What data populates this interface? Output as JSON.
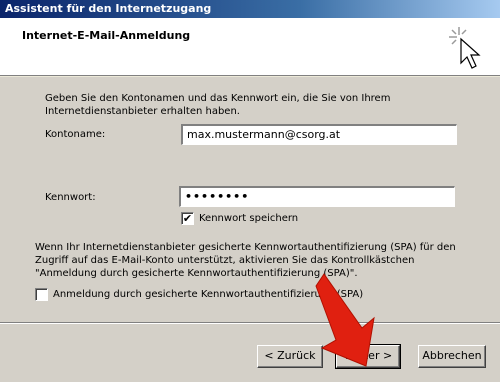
{
  "window": {
    "title": "Assistent für den Internetzugang"
  },
  "header": {
    "heading": "Internet-E-Mail-Anmeldung",
    "icon": "wizard-cursor-icon"
  },
  "intro_text_line1": "Geben Sie den Kontonamen und das Kennwort ein, die Sie von Ihrem",
  "intro_text_line2": "Internetdienstanbieter erhalten haben.",
  "account": {
    "label": "Kontoname:",
    "value": "max.mustermann@csorg.at"
  },
  "password": {
    "label": "Kennwort:",
    "value": "••••••••"
  },
  "remember_password": {
    "label": "Kennwort speichern",
    "checked": true,
    "mark": "✔"
  },
  "spa_text_line1": "Wenn Ihr Internetdienstanbieter gesicherte Kennwortauthentifizierung (SPA) für den",
  "spa_text_line2": "Zugriff auf das E-Mail-Konto unterstützt, aktivieren Sie das Kontrollkästchen",
  "spa_text_line3": "\"Anmeldung durch gesicherte Kennwortauthentifizierung (SPA)\".",
  "spa_checkbox": {
    "label": "Anmeldung durch gesicherte Kennwortauthentifizierung (SPA)",
    "checked": false
  },
  "buttons": {
    "back": "< Zurück",
    "next": "Weiter >",
    "cancel": "Abbrechen"
  },
  "colors": {
    "annotation_arrow": "#e02010"
  }
}
